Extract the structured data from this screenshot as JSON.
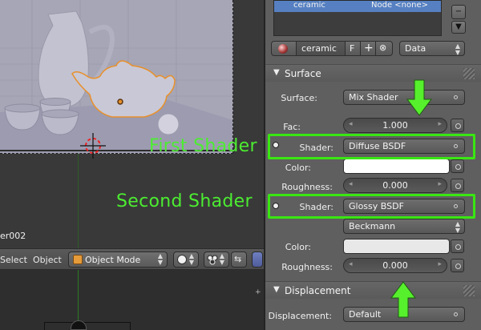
{
  "viewport": {
    "object_label": "er002",
    "header": {
      "menu_select": "Select",
      "menu_object": "Object",
      "mode": "Object Mode"
    }
  },
  "sidebar": {
    "material_slot": {
      "name": "ceramic",
      "node": "Node <none>"
    },
    "material_field": {
      "name": "ceramic",
      "fake_user": "F"
    },
    "link_select": "Data",
    "surface_panel": {
      "title": "Surface",
      "surface_label": "Surface:",
      "surface_value": "Mix Shader",
      "fac_label": "Fac:",
      "fac_value": "1.000",
      "shader1_label": "Shader:",
      "shader1_value": "Diffuse BSDF",
      "color1_label": "Color:",
      "roughness1_label": "Roughness:",
      "roughness1_value": "0.000",
      "shader2_label": "Shader:",
      "shader2_value": "Glossy BSDF",
      "distribution_value": "Beckmann",
      "color2_label": "Color:",
      "roughness2_label": "Roughness:",
      "roughness2_value": "0.000"
    },
    "displacement_panel": {
      "title": "Displacement",
      "displacement_label": "Displacement:",
      "displacement_value": "Default"
    }
  },
  "annotations": {
    "first_shader": "First Shader",
    "second_shader": "Second Shader"
  },
  "colors": {
    "highlight": "#39e612",
    "annotation_text": "#4ced31",
    "selection_outline": "#e8902a",
    "material_row": "#5680c2",
    "color1_swatch": "#ffffff",
    "color2_swatch": "#e8e8e8"
  }
}
